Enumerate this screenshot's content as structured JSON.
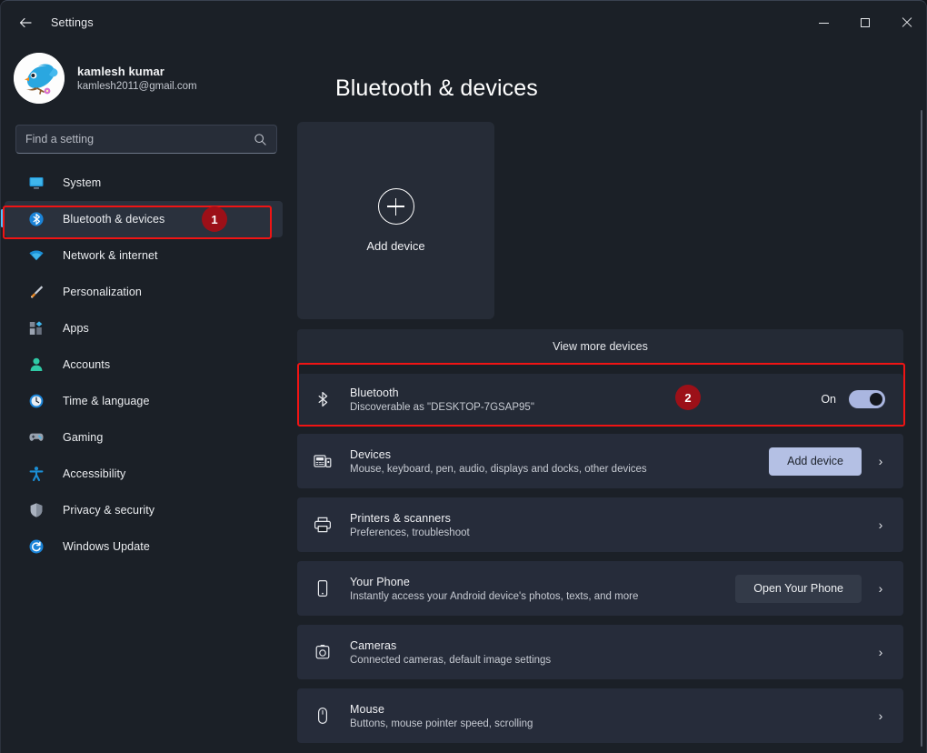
{
  "window": {
    "title": "Settings",
    "back_icon": "back-arrow-icon",
    "minimize_label": "Minimize",
    "maximize_label": "Maximize",
    "close_label": "Close"
  },
  "sidebar": {
    "profile": {
      "name": "kamlesh kumar",
      "email": "kamlesh2011@gmail.com",
      "avatar_icon": "bird-avatar"
    },
    "search": {
      "placeholder": "Find a setting",
      "value": "",
      "icon": "search-icon"
    },
    "items": [
      {
        "label": "System",
        "icon": "monitor-icon",
        "active": false
      },
      {
        "label": "Bluetooth & devices",
        "icon": "bluetooth-icon",
        "active": true
      },
      {
        "label": "Network & internet",
        "icon": "wifi-icon",
        "active": false
      },
      {
        "label": "Personalization",
        "icon": "paintbrush-icon",
        "active": false
      },
      {
        "label": "Apps",
        "icon": "apps-grid-icon",
        "active": false
      },
      {
        "label": "Accounts",
        "icon": "person-icon",
        "active": false
      },
      {
        "label": "Time & language",
        "icon": "clock-icon",
        "active": false
      },
      {
        "label": "Gaming",
        "icon": "gamepad-icon",
        "active": false
      },
      {
        "label": "Accessibility",
        "icon": "accessibility-icon",
        "active": false
      },
      {
        "label": "Privacy & security",
        "icon": "shield-icon",
        "active": false
      },
      {
        "label": "Windows Update",
        "icon": "refresh-icon",
        "active": false
      }
    ]
  },
  "main": {
    "page_title": "Bluetooth & devices",
    "add_device_card": {
      "label": "Add device",
      "icon": "plus-circle-icon"
    },
    "view_more_devices": "View more devices",
    "bluetooth": {
      "title": "Bluetooth",
      "subtitle": "Discoverable as \"DESKTOP-7GSAP95\"",
      "icon": "bluetooth-icon",
      "toggle_state_label": "On",
      "toggle_on": true
    },
    "rows": [
      {
        "title": "Devices",
        "subtitle": "Mouse, keyboard, pen, audio, displays and docks, other devices",
        "icon": "devices-icon",
        "button": {
          "label": "Add device",
          "style": "accent"
        },
        "chevron": "chevron-right-icon"
      },
      {
        "title": "Printers & scanners",
        "subtitle": "Preferences, troubleshoot",
        "icon": "printer-icon",
        "button": null,
        "chevron": "chevron-right-icon"
      },
      {
        "title": "Your Phone",
        "subtitle": "Instantly access your Android device's photos, texts, and more",
        "icon": "phone-icon",
        "button": {
          "label": "Open Your Phone",
          "style": "subtle"
        },
        "chevron": "chevron-right-icon"
      },
      {
        "title": "Cameras",
        "subtitle": "Connected cameras, default image settings",
        "icon": "camera-icon",
        "button": null,
        "chevron": "chevron-right-icon"
      },
      {
        "title": "Mouse",
        "subtitle": "Buttons, mouse pointer speed, scrolling",
        "icon": "mouse-icon",
        "button": null,
        "chevron": "chevron-right-icon"
      }
    ]
  },
  "annotations": {
    "badge_1": "1",
    "badge_2": "2",
    "highlight_color": "#f01414",
    "badge_color": "#9c1018"
  }
}
